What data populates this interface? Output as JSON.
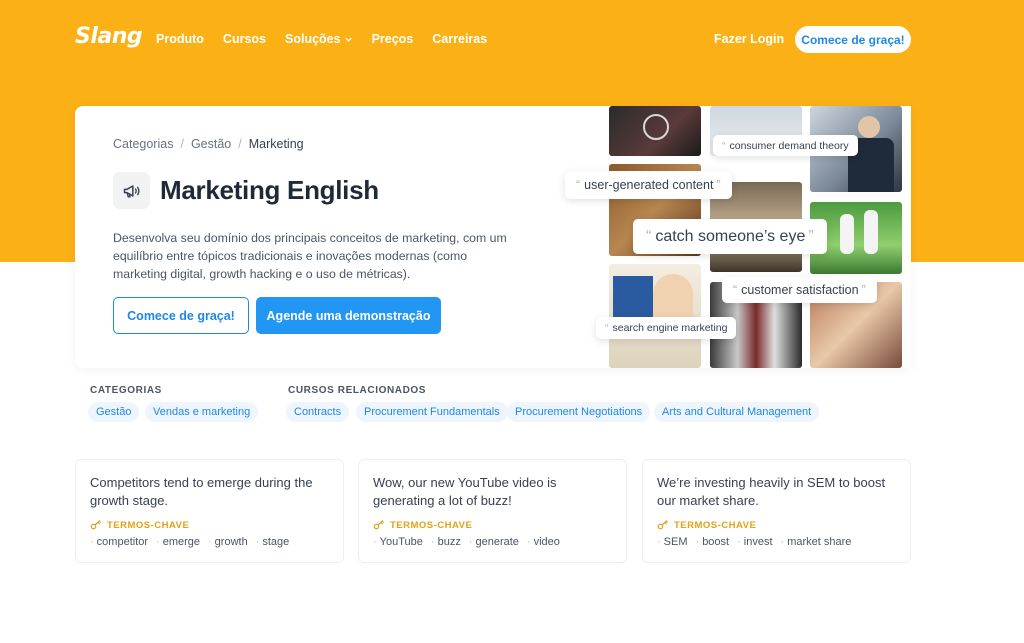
{
  "brand": {
    "logo": "Slang",
    "accent": "#2196f3",
    "band": "#fbb015"
  },
  "nav": {
    "links": [
      "Produto",
      "Cursos",
      "Soluções",
      "Preços",
      "Carreiras"
    ],
    "login": "Fazer Login",
    "cta": "Comece de graça!"
  },
  "breadcrumb": {
    "root": "Categorias",
    "sep": "/",
    "parent": "Gestão",
    "current": "Marketing"
  },
  "hero": {
    "icon": "megaphone-icon",
    "title": "Marketing English",
    "description": "Desenvolva seu domínio dos principais conceitos de marketing, com um equilíbrio entre tópicos tradicionais e inovações modernas (como marketing digital, growth hacking e o uso de métricas).",
    "btn_primary": "Comece de graça!",
    "btn_secondary": "Agende uma demonstração"
  },
  "collage": {
    "phrases": [
      "consumer demand theory",
      "user-generated content",
      "catch someone’s eye",
      "customer satisfaction",
      "search engine marketing"
    ]
  },
  "categories": {
    "label": "CATEGORIAS",
    "items": [
      "Gestão",
      "Vendas e marketing"
    ]
  },
  "related": {
    "label": "CURSOS RELACIONADOS",
    "items": [
      "Contracts",
      "Procurement Fundamentals",
      "Procurement Negotiations",
      "Arts and Cultural Management"
    ]
  },
  "examples": [
    {
      "text": "Competitors  tend to emerge  during the growth  stage.",
      "kw_label": "TERMOS-CHAVE",
      "keywords": [
        "competitor",
        "emerge",
        "growth",
        "stage"
      ]
    },
    {
      "text": "Wow, our new YouTube  video  is generating  a lot of buzz!",
      "kw_label": "TERMOS-CHAVE",
      "keywords": [
        "YouTube",
        "buzz",
        "generate",
        "video"
      ]
    },
    {
      "text": "We’re investing  heavily in SEM  to boost our market share.",
      "kw_label": "TERMOS-CHAVE",
      "keywords": [
        "SEM",
        "boost",
        "invest",
        "market share"
      ]
    }
  ]
}
